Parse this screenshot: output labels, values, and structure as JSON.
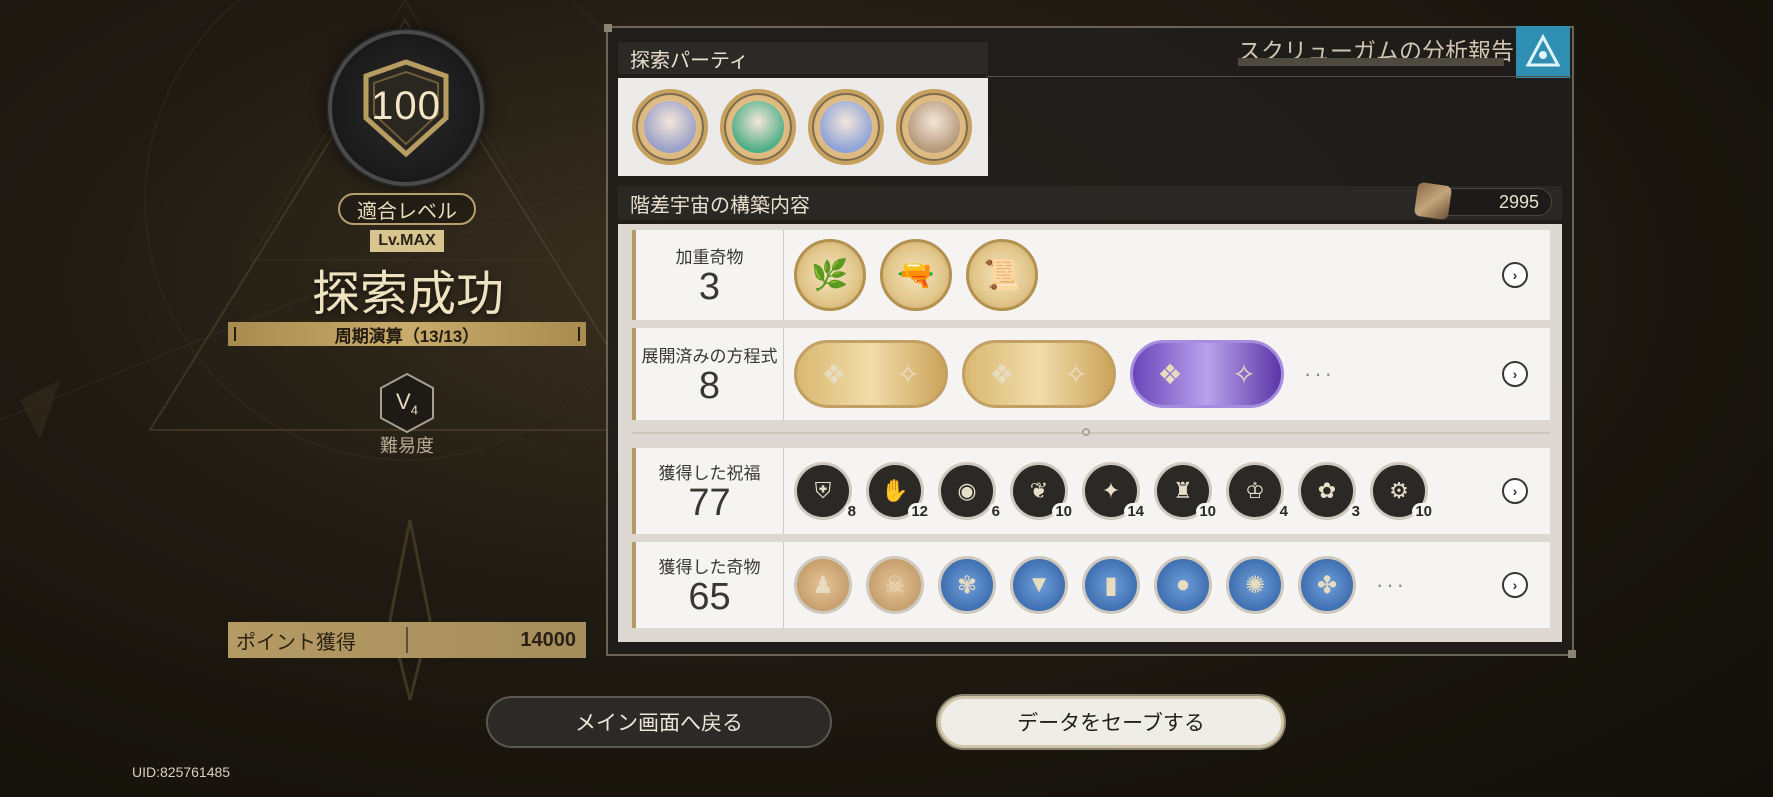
{
  "left": {
    "level": "100",
    "fit_label": "適合レベル",
    "lv_badge": "Lv.MAX",
    "result": "探索成功",
    "cycle": "周期演算（13/13）",
    "difficulty_letter": "V",
    "difficulty_sub": "4",
    "difficulty_label": "難易度",
    "points_label": "ポイント獲得",
    "points_value": "14000",
    "uid": "UID:825761485"
  },
  "report": {
    "title": "スクリューガムの分析報告",
    "icon": "snowflake-triangle-icon"
  },
  "party": {
    "header": "探索パーティ",
    "members": [
      {
        "name": "char-silver-hair",
        "color": "#9aa0c8"
      },
      {
        "name": "char-green-hair",
        "color": "#4fae86"
      },
      {
        "name": "char-blue-hair",
        "color": "#8ea3d8"
      },
      {
        "name": "char-white-hair",
        "color": "#b59a7a"
      }
    ]
  },
  "build": {
    "header": "階差宇宙の構築内容",
    "currency": "2995",
    "rows": {
      "weighted": {
        "label": "加重奇物",
        "count": "3",
        "items": [
          "🌿",
          "🔫",
          "📜"
        ]
      },
      "equations": {
        "label": "展開済みの方程式",
        "count": "8",
        "items": [
          "gold",
          "gold",
          "purple"
        ],
        "more": "···"
      },
      "blessings": {
        "label": "獲得した祝福",
        "count": "77",
        "items": [
          {
            "glyph": "⛨",
            "count": "8"
          },
          {
            "glyph": "✋",
            "count": "12"
          },
          {
            "glyph": "◉",
            "count": "6"
          },
          {
            "glyph": "❦",
            "count": "10"
          },
          {
            "glyph": "✦",
            "count": "14"
          },
          {
            "glyph": "♜",
            "count": "10"
          },
          {
            "glyph": "♔",
            "count": "4"
          },
          {
            "glyph": "✿",
            "count": "3"
          },
          {
            "glyph": "⚙",
            "count": "10"
          }
        ]
      },
      "curios": {
        "label": "獲得した奇物",
        "count": "65",
        "items": [
          {
            "glyph": "♟",
            "tone": "bronze"
          },
          {
            "glyph": "☠",
            "tone": "bronze"
          },
          {
            "glyph": "✾",
            "tone": "blue"
          },
          {
            "glyph": "▼",
            "tone": "blue"
          },
          {
            "glyph": "▮",
            "tone": "blue"
          },
          {
            "glyph": "●",
            "tone": "blue"
          },
          {
            "glyph": "✺",
            "tone": "blue"
          },
          {
            "glyph": "✤",
            "tone": "blue"
          }
        ],
        "more": "···"
      }
    },
    "arrow": "›"
  },
  "buttons": {
    "back": "メイン画面へ戻る",
    "save": "データをセーブする"
  },
  "colors": {
    "gold": "#c9ab6b",
    "panel": "#f5f4f2",
    "accent_blue": "#2f8fb2"
  }
}
